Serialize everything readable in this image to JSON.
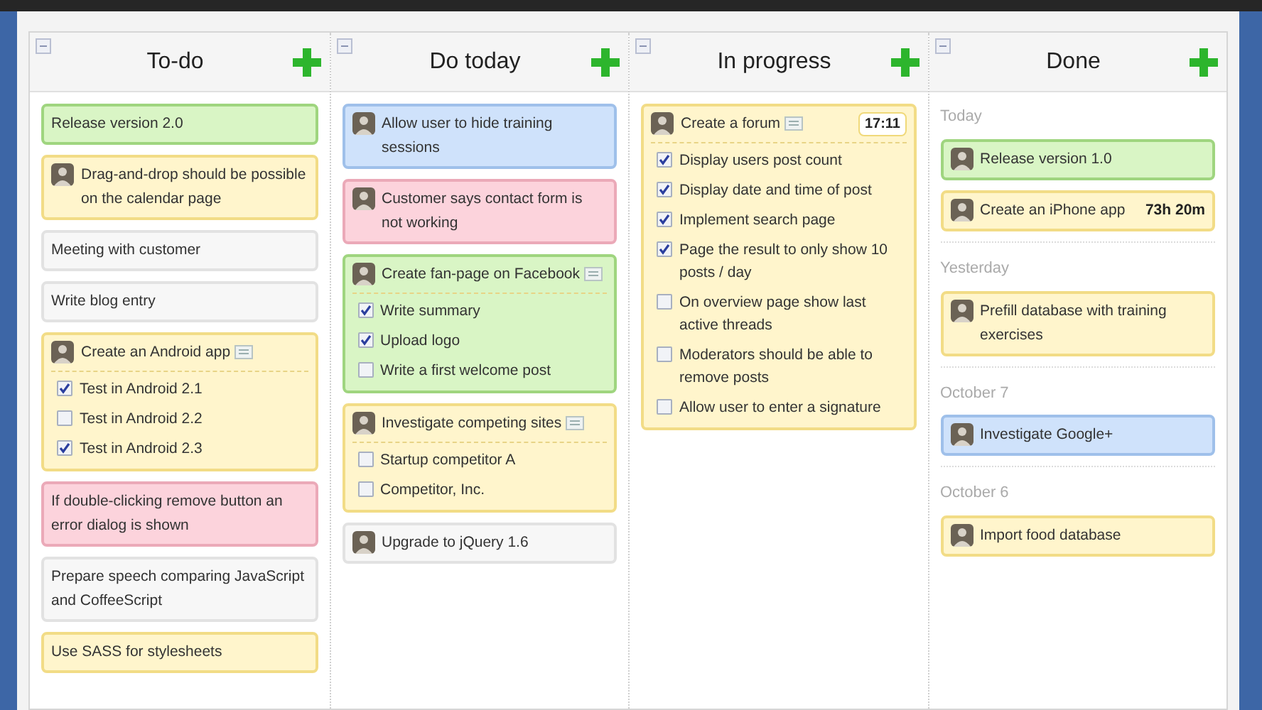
{
  "columns": [
    {
      "title": "To-do",
      "items": [
        {
          "kind": "card",
          "title": "Release version 2.0",
          "color": "#d9f5c5",
          "avatar": false,
          "note": false
        },
        {
          "kind": "card",
          "title": "Drag-and-drop should be possible on the calendar page",
          "color": "#fff5cc",
          "avatar": true,
          "note": false
        },
        {
          "kind": "card",
          "title": "Meeting with customer",
          "color": "#f7f7f7",
          "avatar": false,
          "note": false
        },
        {
          "kind": "card",
          "title": "Write blog entry",
          "color": "#f7f7f7",
          "avatar": false,
          "note": false
        },
        {
          "kind": "card",
          "title": "Create an Android app",
          "color": "#fff5cc",
          "avatar": true,
          "note": true,
          "subtasks": [
            {
              "label": "Test in Android 2.1",
              "checked": true
            },
            {
              "label": "Test in Android 2.2",
              "checked": false
            },
            {
              "label": "Test in Android 2.3",
              "checked": true
            }
          ]
        },
        {
          "kind": "card",
          "title": "If double-clicking remove button an error dialog is shown",
          "color": "#fcd3dc",
          "avatar": false,
          "note": false
        },
        {
          "kind": "card",
          "title": "Prepare speech comparing JavaScript and CoffeeScript",
          "color": "#f7f7f7",
          "avatar": false,
          "note": false
        },
        {
          "kind": "card",
          "title": "Use SASS for stylesheets",
          "color": "#fff5cc",
          "avatar": false,
          "note": false
        }
      ]
    },
    {
      "title": "Do today",
      "items": [
        {
          "kind": "card",
          "title": "Allow user to hide training sessions",
          "color": "#cfe2fb",
          "avatar": true,
          "note": false
        },
        {
          "kind": "card",
          "title": "Customer says contact form is not working",
          "color": "#fcd3dc",
          "avatar": true,
          "note": false
        },
        {
          "kind": "card",
          "title": "Create fan-page on Facebook",
          "color": "#d9f5c5",
          "avatar": true,
          "note": true,
          "subtasks": [
            {
              "label": "Write summary",
              "checked": true
            },
            {
              "label": "Upload logo",
              "checked": true
            },
            {
              "label": "Write a first welcome post",
              "checked": false
            }
          ]
        },
        {
          "kind": "card",
          "title": "Investigate competing sites",
          "color": "#fff5cc",
          "avatar": true,
          "note": true,
          "subtasks": [
            {
              "label": "Startup competitor A",
              "checked": false
            },
            {
              "label": "Competitor, Inc.",
              "checked": false
            }
          ]
        },
        {
          "kind": "card",
          "title": "Upgrade to jQuery 1.6",
          "color": "#f7f7f7",
          "avatar": true,
          "note": false
        }
      ]
    },
    {
      "title": "In progress",
      "items": [
        {
          "kind": "card",
          "title": "Create a forum",
          "color": "#fff5cc",
          "avatar": true,
          "note": true,
          "timer": "17:11",
          "subtasks": [
            {
              "label": "Display users post count",
              "checked": true
            },
            {
              "label": "Display date and time of post",
              "checked": true
            },
            {
              "label": "Implement search page",
              "checked": true
            },
            {
              "label": "Page the result to only show 10 posts / day",
              "checked": true
            },
            {
              "label": "On overview page show last active threads",
              "checked": false
            },
            {
              "label": "Moderators should be able to remove posts",
              "checked": false
            },
            {
              "label": "Allow user to enter a signature",
              "checked": false
            }
          ]
        }
      ]
    },
    {
      "title": "Done",
      "items": [
        {
          "kind": "date",
          "label": "Today"
        },
        {
          "kind": "card",
          "title": "Release version 1.0",
          "color": "#d9f5c5",
          "avatar": true,
          "note": false
        },
        {
          "kind": "card",
          "title": "Create an iPhone app",
          "color": "#fff5cc",
          "avatar": true,
          "note": false,
          "time": "73h 20m"
        },
        {
          "kind": "date",
          "label": "Yesterday"
        },
        {
          "kind": "card",
          "title": "Prefill database with training exercises",
          "color": "#fff5cc",
          "avatar": true,
          "note": false
        },
        {
          "kind": "date",
          "label": "October 7"
        },
        {
          "kind": "card",
          "title": "Investigate Google+",
          "color": "#cfe2fb",
          "avatar": true,
          "note": false
        },
        {
          "kind": "date",
          "label": "October 6"
        },
        {
          "kind": "card",
          "title": "Import food database",
          "color": "#fff5cc",
          "avatar": true,
          "note": false
        }
      ]
    }
  ]
}
